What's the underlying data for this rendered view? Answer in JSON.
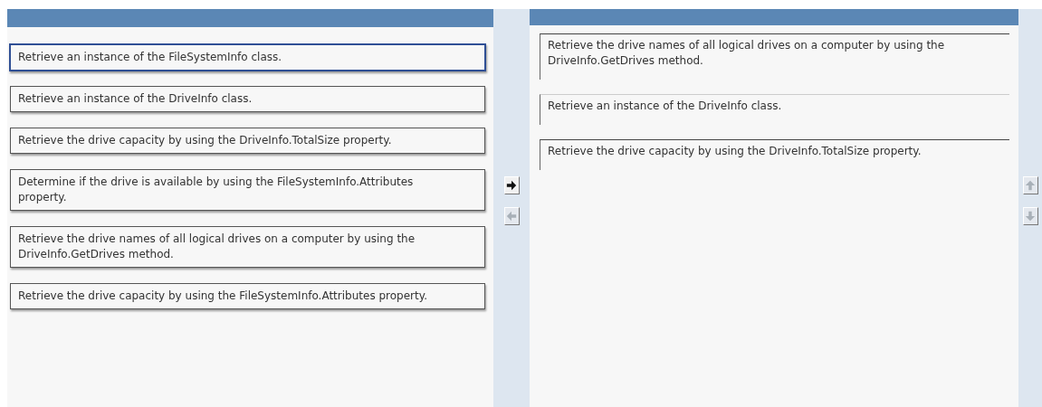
{
  "source_items": [
    {
      "text": "Retrieve an instance of the FileSystemInfo class.",
      "selected": true
    },
    {
      "text": "Retrieve an instance of the DriveInfo class.",
      "selected": false
    },
    {
      "text": "Retrieve the drive capacity by using the DriveInfo.TotalSize property.",
      "selected": false
    },
    {
      "text": "Determine if the drive is available by using the FileSystemInfo.Attributes property.",
      "selected": false
    },
    {
      "text": "Retrieve the drive names of all logical drives on a computer by using the DriveInfo.GetDrives method.",
      "selected": false
    },
    {
      "text": "Retrieve the drive capacity by using the FileSystemInfo.Attributes property.",
      "selected": false
    }
  ],
  "transfer_buttons": [
    {
      "kind": "right",
      "disabled": false
    },
    {
      "kind": "left",
      "disabled": true
    }
  ],
  "answer_items": [
    {
      "text": "Retrieve the drive names of all logical drives on a computer by using the DriveInfo.GetDrives method."
    },
    {
      "text": "Retrieve an instance of the DriveInfo class."
    },
    {
      "text": "Retrieve the drive capacity by using the DriveInfo.TotalSize property."
    }
  ],
  "order_buttons": [
    {
      "kind": "up",
      "disabled": true
    },
    {
      "kind": "down",
      "disabled": true
    }
  ]
}
